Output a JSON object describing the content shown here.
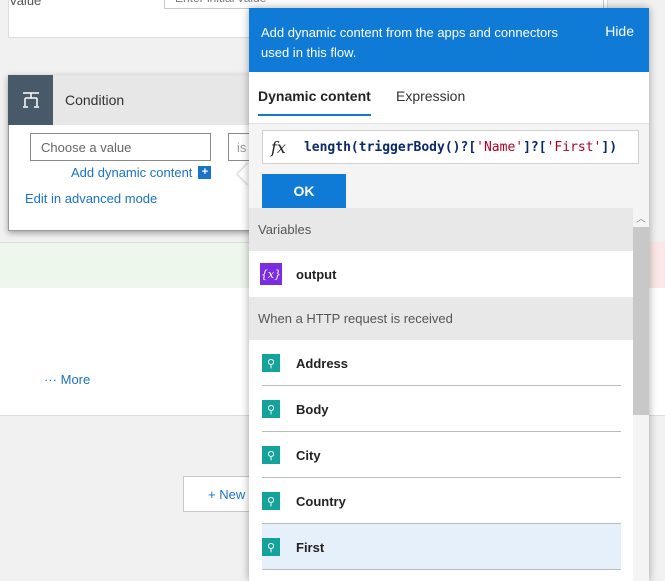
{
  "top_card": {
    "label": "Value",
    "placeholder": "Enter initial value"
  },
  "condition": {
    "title": "Condition",
    "choose_value": "Choose a value",
    "second_value": "is",
    "add_dynamic": "Add dynamic content",
    "advanced": "Edit in advanced mode"
  },
  "more_label": "More",
  "new_label": "+ New",
  "flyout": {
    "header": "Add dynamic content from the apps and connectors used in this flow.",
    "hide": "Hide",
    "tabs": [
      "Dynamic content",
      "Expression"
    ],
    "fx": "fx",
    "expression": {
      "p1": "length(triggerBody()?[",
      "s1": "'Name'",
      "p2": "]?[",
      "s2": "'First'",
      "p3": "])"
    },
    "ok": "OK",
    "sections": [
      {
        "title": "Variables",
        "items": [
          {
            "name": "output",
            "icon": "{x}"
          }
        ]
      },
      {
        "title": "When a HTTP request is received",
        "items": [
          {
            "name": "Address"
          },
          {
            "name": "Body"
          },
          {
            "name": "City"
          },
          {
            "name": "Country"
          },
          {
            "name": "First"
          }
        ]
      }
    ],
    "selected_item": "First"
  },
  "colors": {
    "accent": "#0f7bd7",
    "variable": "#7b2ee1",
    "request": "#13a39b"
  }
}
